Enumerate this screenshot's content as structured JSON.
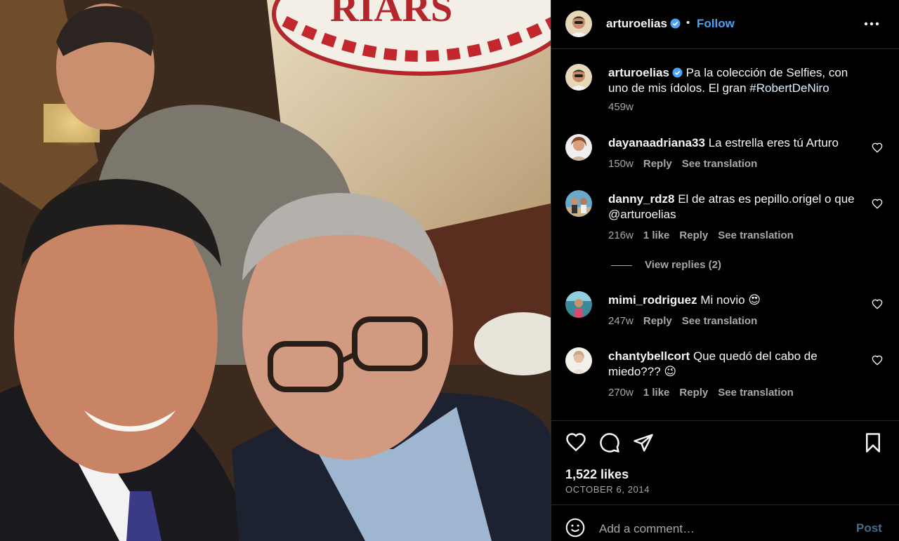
{
  "photo": {
    "sign_text": "RIARS",
    "description_icon": "photo"
  },
  "header": {
    "username": "arturoelias",
    "dot": "•",
    "follow_label": "Follow",
    "more_icon": "more-horizontal-icon"
  },
  "caption": {
    "username": "arturoelias",
    "text": "Pa la colección de Selfies, con uno de mis ídolos. El gran ",
    "hashtag": "#RobertDeNiro",
    "time": "459w"
  },
  "comments": [
    {
      "username": "dayanaadriana33",
      "text": "La estrella eres tú Arturo",
      "time": "150w",
      "likes": "",
      "reply": "Reply",
      "translate": "See translation"
    },
    {
      "username": "danny_rdz8",
      "text": "El de atras es pepillo.origel o que @arturoelias",
      "time": "216w",
      "likes": "1 like",
      "reply": "Reply",
      "translate": "See translation"
    },
    {
      "username": "mimi_rodriguez",
      "text": "Mi novio 😍",
      "time": "247w",
      "likes": "",
      "reply": "Reply",
      "translate": "See translation"
    },
    {
      "username": "chantybellcort",
      "text": "Que quedó del cabo de miedo??? 😉",
      "time": "270w",
      "likes": "1 like",
      "reply": "Reply",
      "translate": "See translation"
    }
  ],
  "view_replies": "View replies (2)",
  "actions": {
    "likes": "1,522 likes",
    "date": "OCTOBER 6, 2014"
  },
  "add_comment": {
    "placeholder": "Add a comment…",
    "post_label": "Post"
  },
  "colors": {
    "background": "#000000",
    "text": "#f5f5f5",
    "secondary": "#a8a8a8",
    "link": "#4aa3f5",
    "verified": "#4aa3f5"
  }
}
